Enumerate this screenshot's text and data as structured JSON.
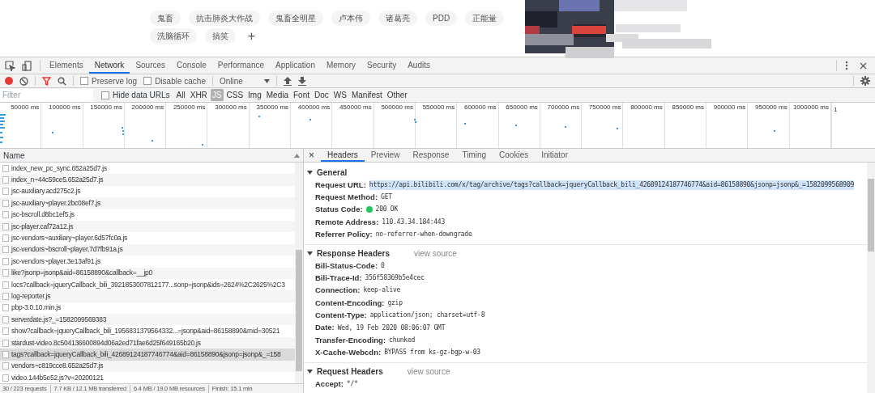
{
  "page": {
    "tags": [
      {
        "label": "鬼畜"
      },
      {
        "label": "抗击肺炎大作战"
      },
      {
        "label": "鬼畜全明星"
      },
      {
        "label": "卢本伟"
      },
      {
        "label": "诸葛亮"
      },
      {
        "label": "PDD"
      },
      {
        "label": "正能量"
      },
      {
        "label": "洗脑循环"
      },
      {
        "label": "搞笑"
      }
    ],
    "add_tag": "+"
  },
  "devtools": {
    "tabs": [
      {
        "label": "Elements",
        "selected": false
      },
      {
        "label": "Network",
        "selected": true
      },
      {
        "label": "Sources",
        "selected": false
      },
      {
        "label": "Console",
        "selected": false
      },
      {
        "label": "Performance",
        "selected": false
      },
      {
        "label": "Application",
        "selected": false
      },
      {
        "label": "Memory",
        "selected": false
      },
      {
        "label": "Security",
        "selected": false
      },
      {
        "label": "Audits",
        "selected": false
      }
    ],
    "toolbar": {
      "recording": true,
      "preserve_log": {
        "label": "Preserve log",
        "checked": false
      },
      "disable_cache": {
        "label": "Disable cache",
        "checked": false
      },
      "throttling": "Online"
    },
    "filter": {
      "placeholder": "Filter",
      "hide_data_urls": {
        "label": "Hide data URLs",
        "checked": false
      },
      "types": [
        {
          "label": "All",
          "selected": false
        },
        {
          "label": "XHR",
          "selected": false
        },
        {
          "label": "JS",
          "selected": true
        },
        {
          "label": "CSS",
          "selected": false
        },
        {
          "label": "Img",
          "selected": false
        },
        {
          "label": "Media",
          "selected": false
        },
        {
          "label": "Font",
          "selected": false
        },
        {
          "label": "Doc",
          "selected": false
        },
        {
          "label": "WS",
          "selected": false
        },
        {
          "label": "Manifest",
          "selected": false
        },
        {
          "label": "Other",
          "selected": false
        }
      ]
    },
    "overview_ticks": [
      "50000 ms",
      "100000 ms",
      "150000 ms",
      "200000 ms",
      "250000 ms",
      "300000 ms",
      "350000 ms",
      "400000 ms",
      "450000 ms",
      "500000 ms",
      "550000 ms",
      "600000 ms",
      "650000 ms",
      "700000 ms",
      "750000 ms",
      "800000 ms",
      "850000 ms",
      "900000 ms",
      "950000 ms",
      "1000000 ms",
      "1"
    ],
    "requests": {
      "column": "Name",
      "rows": [
        {
          "name": "index_new_pc_sync.652a25d7.js",
          "selected": false
        },
        {
          "name": "index_n~44c59ce5.652a25d7.js",
          "selected": false
        },
        {
          "name": "jsc-auxiliary.acd275c2.js",
          "selected": false
        },
        {
          "name": "jsc-auxiliary~player.2bc08ef7.js",
          "selected": false
        },
        {
          "name": "jsc-bscroll.d8bc1ef5.js",
          "selected": false
        },
        {
          "name": "jsc-player.caf72a12.js",
          "selected": false
        },
        {
          "name": "jsc-vendors~auxiliary~player.6d57fc0a.js",
          "selected": false
        },
        {
          "name": "jsc-vendors~bscroll~player.7d7fb91a.js",
          "selected": false
        },
        {
          "name": "jsc-vendors~player.3e13af91.js",
          "selected": false
        },
        {
          "name": "like?jsonp=jsonp&aid=86158890&callback=__jp0",
          "selected": false
        },
        {
          "name": "locs?callback=jqueryCallback_bili_3921853007812177...sonp=jsonp&ids=2624%2C2625%2C3",
          "selected": false
        },
        {
          "name": "log-reporter.js",
          "selected": false
        },
        {
          "name": "pbp-3.0.10.min.js",
          "selected": false
        },
        {
          "name": "serverdate.js?_=1582099569383",
          "selected": false
        },
        {
          "name": "show?callback=jqueryCallback_bili_1956831379564332...=jsonp&aid=86158890&mid=30521",
          "selected": false
        },
        {
          "name": "stardust-video.8c504136600894d06a2ed71fae6d25f649165b20.js",
          "selected": false
        },
        {
          "name": "tags?callback=jqueryCallback_bili_42689124187746774&aid=86158890&jsonp=jsonp&_=158",
          "selected": true
        },
        {
          "name": "vendors~c819cce8.652a25d7.js",
          "selected": false
        },
        {
          "name": "video.144b5e52.js?v=20200121",
          "selected": false
        }
      ]
    },
    "status_bar": [
      "30 / 223 requests",
      "7.7 KB / 12.1 MB transferred",
      "6.4 MB / 19.0 MB resources",
      "Finish: 15.1 min"
    ],
    "detail": {
      "close": "×",
      "tabs": [
        {
          "label": "Headers",
          "selected": true
        },
        {
          "label": "Preview",
          "selected": false
        },
        {
          "label": "Response",
          "selected": false
        },
        {
          "label": "Timing",
          "selected": false
        },
        {
          "label": "Cookies",
          "selected": false
        },
        {
          "label": "Initiator",
          "selected": false
        }
      ],
      "sections": [
        {
          "title": "General",
          "expanded": true,
          "headers": [
            {
              "name": "Request URL:",
              "value": "https://api.bilibili.com/x/tag/archive/tags?callback=jqueryCallback_bili_42689124187746774&aid=86158890&jsonp=jsonp&_=1582099568909",
              "highlighted": true
            },
            {
              "name": "Request Method:",
              "value": "GET"
            },
            {
              "name": "Status Code:",
              "value": "200 OK",
              "kind": "status",
              "color": "#22c55e"
            },
            {
              "name": "Remote Address:",
              "value": "110.43.34.184:443"
            },
            {
              "name": "Referrer Policy:",
              "value": "no-referrer-when-downgrade"
            }
          ]
        },
        {
          "title": "Response Headers",
          "expanded": true,
          "link": "view source",
          "headers": [
            {
              "name": "Bili-Status-Code:",
              "value": "0"
            },
            {
              "name": "Bili-Trace-Id:",
              "value": "356f58369b5e4cec"
            },
            {
              "name": "Connection:",
              "value": "keep-alive"
            },
            {
              "name": "Content-Encoding:",
              "value": "gzip"
            },
            {
              "name": "Content-Type:",
              "value": "application/json; charset=utf-8"
            },
            {
              "name": "Date:",
              "value": "Wed, 19 Feb 2020 08:06:07 GMT"
            },
            {
              "name": "Transfer-Encoding:",
              "value": "chunked"
            },
            {
              "name": "X-Cache-Webcdn:",
              "value": "BYPASS from ks-gz-bgp-w-03"
            }
          ]
        },
        {
          "title": "Request Headers",
          "expanded": true,
          "link": "view source",
          "headers": [
            {
              "name": "Accept:",
              "value": "*/*"
            }
          ]
        }
      ]
    }
  }
}
